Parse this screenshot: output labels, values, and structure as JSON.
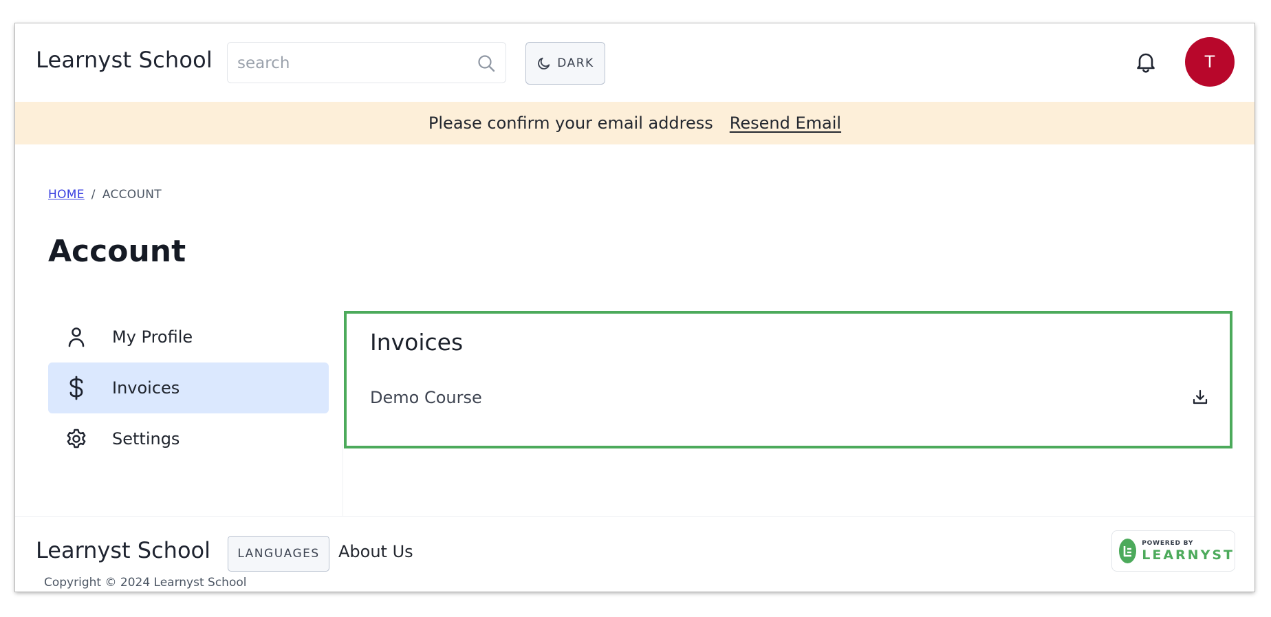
{
  "header": {
    "brand": "Learnyst School",
    "search_placeholder": "search",
    "search_value": "",
    "theme_button_label": "DARK",
    "avatar_initial": "T"
  },
  "banner": {
    "message": "Please confirm your email address",
    "resend_label": "Resend Email"
  },
  "breadcrumb": {
    "home": "HOME",
    "separator": "/",
    "current": "ACCOUNT"
  },
  "page": {
    "title": "Account"
  },
  "sidebar": {
    "items": [
      {
        "label": "My Profile",
        "icon": "user-icon",
        "active": false
      },
      {
        "label": "Invoices",
        "icon": "dollar-icon",
        "active": true
      },
      {
        "label": "Settings",
        "icon": "gear-icon",
        "active": false
      }
    ]
  },
  "invoices": {
    "title": "Invoices",
    "rows": [
      {
        "course": "Demo Course",
        "action_icon": "download-icon"
      }
    ]
  },
  "footer": {
    "brand": "Learnyst School",
    "languages_label": "LANGUAGES",
    "about_label": "About Us",
    "copyright": "Copyright © 2024 Learnyst School",
    "powered_small": "POWERED BY",
    "powered_big": "LEARNYST"
  },
  "colors": {
    "avatar": "#b8072b",
    "banner_bg": "#fdefd9",
    "active_item_bg": "#dbe8fe",
    "panel_border": "#4caa5b",
    "link": "#3b41e0",
    "learnyst_green": "#4caa5b"
  }
}
